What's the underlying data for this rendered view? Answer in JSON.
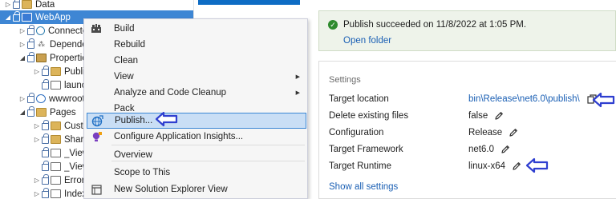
{
  "explorer": {
    "items": [
      {
        "label": "Data",
        "indent": 0,
        "twisty": "▷",
        "icon": "folder-icon",
        "kind": "folder"
      },
      {
        "label": "WebApp",
        "indent": 0,
        "twisty": "◢",
        "icon": "project-icon",
        "kind": "project",
        "selected": true
      },
      {
        "label": "Connected",
        "indent": 1,
        "twisty": "▷",
        "icon": "connected-services-icon",
        "kind": "svc"
      },
      {
        "label": "Dependen",
        "indent": 1,
        "twisty": "▷",
        "icon": "dependencies-icon",
        "kind": "dep"
      },
      {
        "label": "Properties",
        "indent": 1,
        "twisty": "◢",
        "icon": "properties-icon",
        "kind": "props"
      },
      {
        "label": "Publish",
        "indent": 2,
        "twisty": "▷",
        "icon": "folder-icon",
        "kind": "folder"
      },
      {
        "label": "launch",
        "indent": 2,
        "twisty": "",
        "icon": "json-file-icon",
        "kind": "file"
      },
      {
        "label": "wwwroot",
        "indent": 1,
        "twisty": "▷",
        "icon": "globe-icon",
        "kind": "globe"
      },
      {
        "label": "Pages",
        "indent": 1,
        "twisty": "◢",
        "icon": "folder-icon",
        "kind": "folder"
      },
      {
        "label": "Custon",
        "indent": 2,
        "twisty": "▷",
        "icon": "folder-icon",
        "kind": "folder"
      },
      {
        "label": "Shared",
        "indent": 2,
        "twisty": "▷",
        "icon": "folder-icon",
        "kind": "folder"
      },
      {
        "label": "_ViewIr",
        "indent": 2,
        "twisty": "",
        "icon": "razor-file-icon",
        "kind": "file"
      },
      {
        "label": "_ViewS",
        "indent": 2,
        "twisty": "",
        "icon": "razor-file-icon",
        "kind": "file"
      },
      {
        "label": "Error.cs",
        "indent": 2,
        "twisty": "▷",
        "icon": "razor-file-icon",
        "kind": "file"
      },
      {
        "label": "Index.c",
        "indent": 2,
        "twisty": "▷",
        "icon": "razor-file-icon",
        "kind": "file"
      }
    ]
  },
  "context_menu": {
    "items": [
      {
        "label": "Build",
        "icon": "build-icon"
      },
      {
        "label": "Rebuild",
        "icon": ""
      },
      {
        "label": "Clean",
        "icon": ""
      },
      {
        "label": "View",
        "icon": "",
        "submenu": true
      },
      {
        "label": "Analyze and Code Cleanup",
        "icon": "",
        "submenu": true
      },
      {
        "label": "Pack",
        "icon": ""
      },
      {
        "label": "Publish...",
        "icon": "publish-globe-icon",
        "highlighted": true
      },
      {
        "label": "Configure Application Insights...",
        "icon": "app-insights-icon"
      },
      {
        "separator": true
      },
      {
        "label": "Overview",
        "icon": ""
      },
      {
        "separator": true
      },
      {
        "label": "Scope to This",
        "icon": ""
      },
      {
        "label": "New Solution Explorer View",
        "icon": "new-view-icon"
      }
    ]
  },
  "publish": {
    "success_text": "Publish succeeded on 11/8/2022 at 1:05 PM.",
    "open_folder": "Open folder",
    "settings_heading": "Settings",
    "rows": [
      {
        "label": "Target location",
        "value": "bin\\Release\\net6.0\\publish\\",
        "link": true,
        "action": "copy"
      },
      {
        "label": "Delete existing files",
        "value": "false",
        "action": "edit"
      },
      {
        "label": "Configuration",
        "value": "Release",
        "action": "edit"
      },
      {
        "label": "Target Framework",
        "value": "net6.0",
        "action": "edit"
      },
      {
        "label": "Target Runtime",
        "value": "linux-x64",
        "action": "edit"
      }
    ],
    "show_all": "Show all settings"
  },
  "colors": {
    "selection": "#3e86d4",
    "menu_highlight": "#c9def5",
    "link": "#1a5fb4",
    "success": "#2e8b2e",
    "annotation_arrow": "#2f3fd0"
  }
}
